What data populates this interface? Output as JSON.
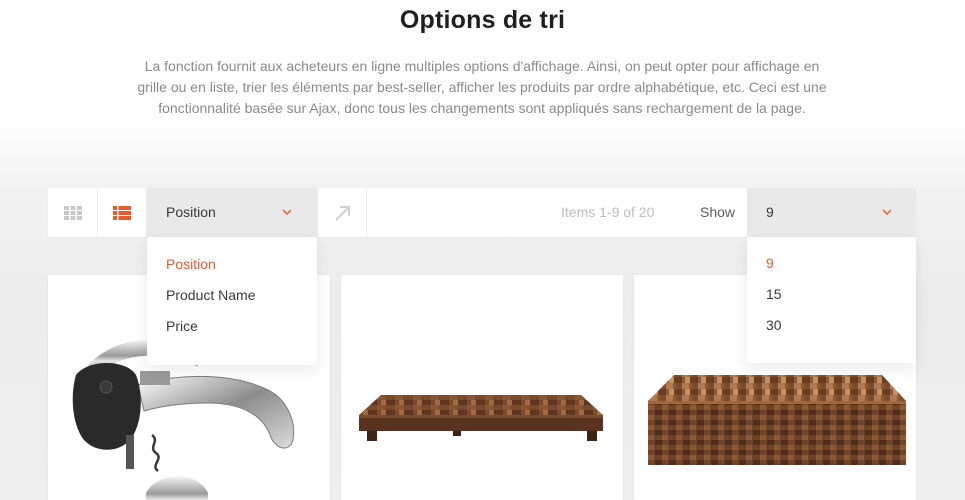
{
  "header": {
    "title": "Options de tri",
    "description": "La fonction fournit aux acheteurs en ligne multiples options d'affichage. Ainsi, on peut opter pour affichage en grille ou en liste, trier les éléments par best-seller, afficher les produits par ordre alphabétique, etc. Ceci est une fonctionnalité basée sur Ajax, donc tous les changements sont appliqués sans rechargement de la page."
  },
  "toolbar": {
    "grid_view_icon": "grid-icon",
    "list_view_icon": "list-icon",
    "active_view": "list",
    "sort_by": {
      "selected": "Position",
      "options": [
        "Position",
        "Product Name",
        "Price"
      ]
    },
    "sort_direction_icon": "arrow-up-right-icon",
    "items_count": "Items 1-9 of 20",
    "show_label": "Show",
    "show": {
      "selected": "9",
      "options": [
        "9",
        "15",
        "30"
      ]
    }
  },
  "products": [
    {
      "image": "corkscrew"
    },
    {
      "image": "cutting-board-legs"
    },
    {
      "image": "end-grain-butcher-block"
    }
  ],
  "colors": {
    "accent": "#e85c2c",
    "select_bg": "#e9e9e9",
    "text_muted": "#8a8a8a"
  }
}
